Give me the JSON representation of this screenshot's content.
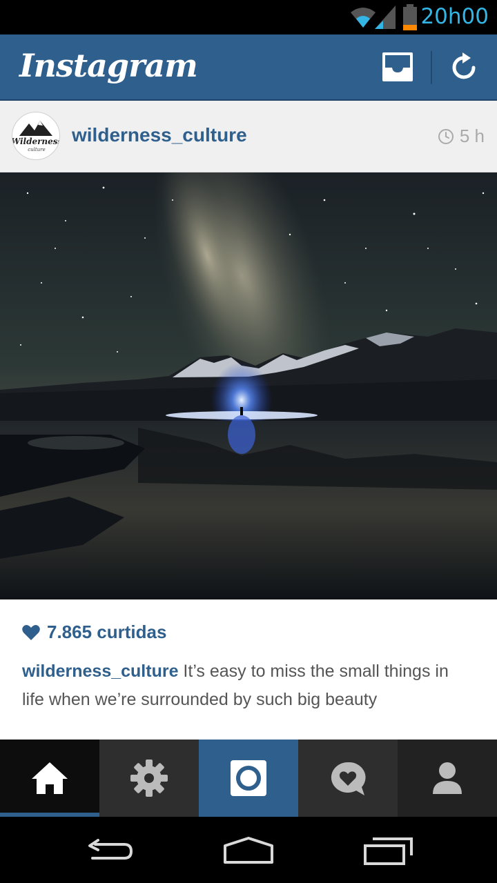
{
  "status_bar": {
    "time": "20h00"
  },
  "header": {
    "app_title": "Instagram",
    "inbox_icon": "inbox-icon",
    "refresh_icon": "refresh-icon",
    "brand_color": "#2f5f8c"
  },
  "post": {
    "username": "wilderness_culture",
    "avatar_text": "Wilderness culture",
    "time_ago": "5 h",
    "likes": "7.865 curtidas",
    "caption_user": "wilderness_culture",
    "caption_text": " It’s easy to miss the small things in life when we’re surrounded by such big beauty"
  },
  "tabs": [
    {
      "name": "home",
      "icon": "home-icon",
      "selected": true
    },
    {
      "name": "explore",
      "icon": "explore-icon",
      "selected": false
    },
    {
      "name": "camera",
      "icon": "camera-icon",
      "selected": false
    },
    {
      "name": "news",
      "icon": "news-icon",
      "selected": false
    },
    {
      "name": "profile",
      "icon": "profile-icon",
      "selected": false
    }
  ],
  "nav_bar": {
    "back_icon": "back-icon",
    "home_icon": "nav-home-icon",
    "recents_icon": "recents-icon"
  }
}
